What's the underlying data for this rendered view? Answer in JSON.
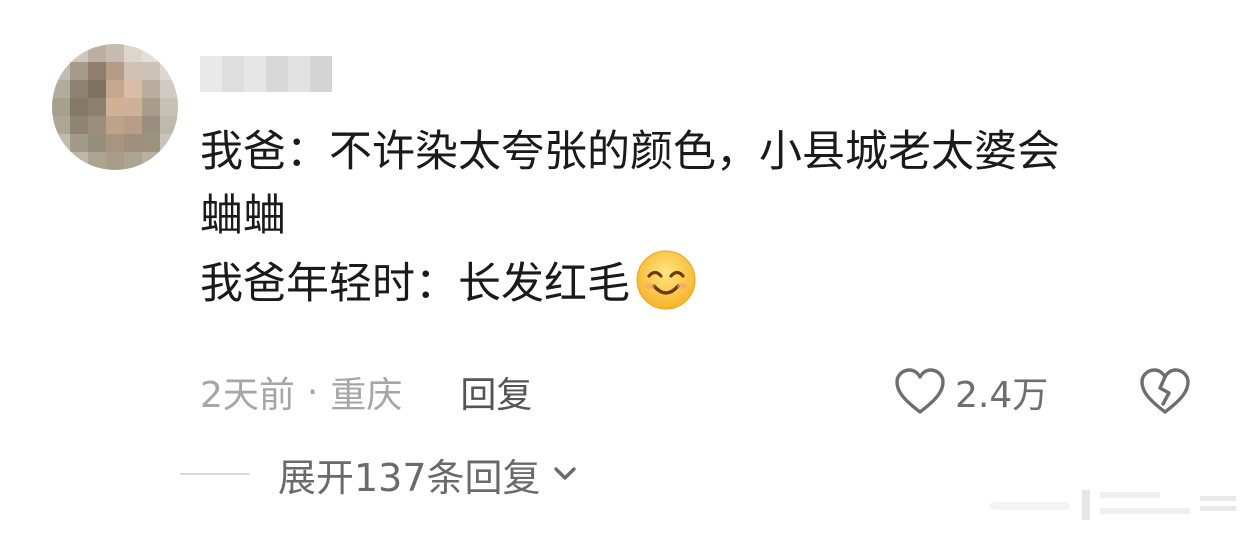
{
  "comment": {
    "lines": [
      "我爸：不许染太夸张的颜色，小县城老太婆会",
      "蛐蛐",
      "我爸年轻时：长发红毛"
    ],
    "emoji": "smiling-face-emoji"
  },
  "meta": {
    "time": "2天前",
    "separator": "·",
    "location": "重庆",
    "reply_label": "回复"
  },
  "likes": {
    "count": "2.4万",
    "icon": "heart-outline-icon"
  },
  "dislike": {
    "icon": "broken-heart-icon"
  },
  "expand": {
    "label": "展开137条回复",
    "icon": "chevron-down-icon"
  },
  "colors": {
    "text": "#1a1a1a",
    "meta": "#a6a6a6",
    "reply": "#555555",
    "icon": "#6e6e6e"
  }
}
